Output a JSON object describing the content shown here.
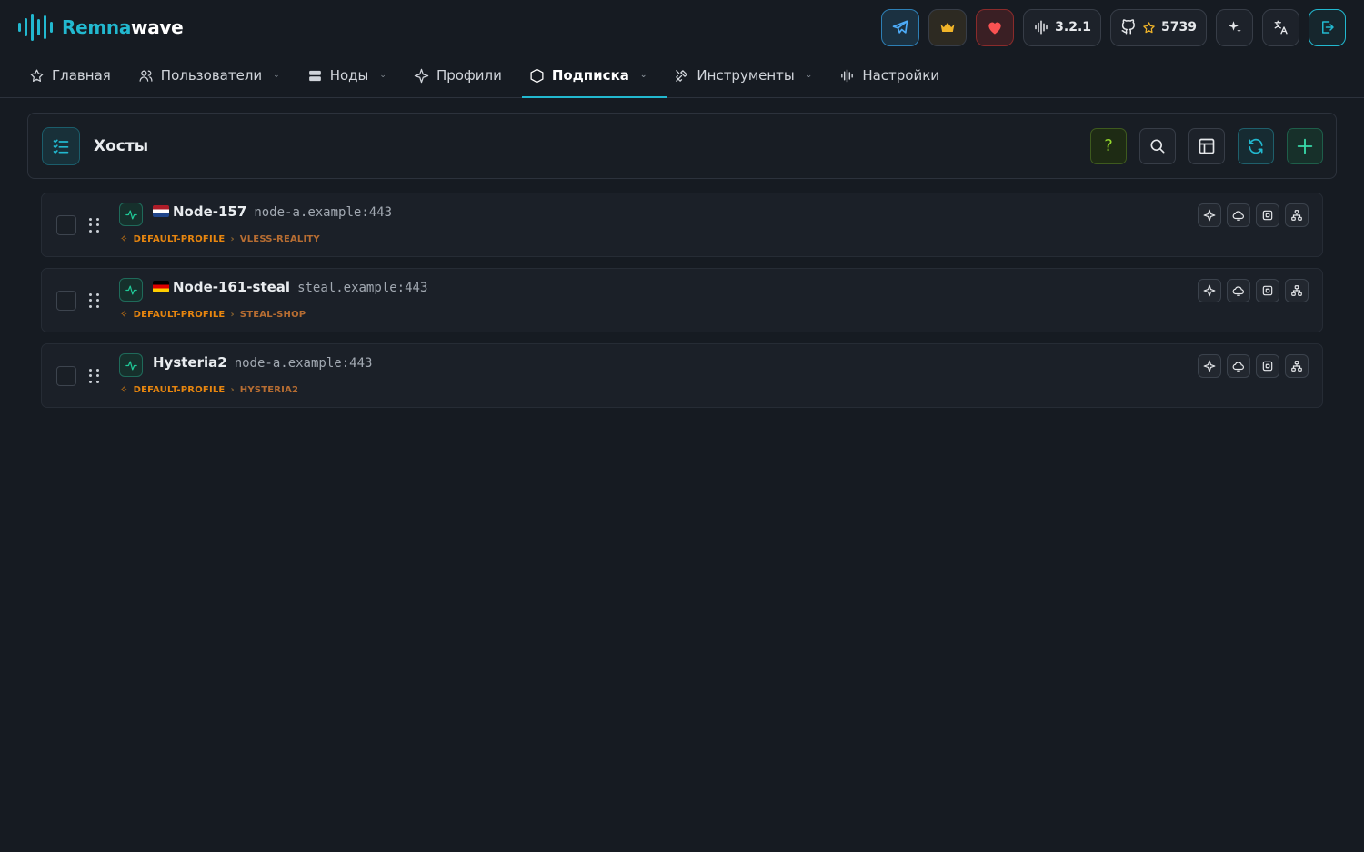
{
  "brand": {
    "name_part1": "Remna",
    "name_part2": "wave"
  },
  "top_actions": {
    "version": "3.2.1",
    "github_stars": "5739"
  },
  "nav": [
    {
      "label": "Главная",
      "icon": "star-icon",
      "has_dropdown": false
    },
    {
      "label": "Пользователи",
      "icon": "users-icon",
      "has_dropdown": true
    },
    {
      "label": "Ноды",
      "icon": "server-icon",
      "has_dropdown": true
    },
    {
      "label": "Профили",
      "icon": "sparkle-icon",
      "has_dropdown": false
    },
    {
      "label": "Подписка",
      "icon": "hexagon-icon",
      "has_dropdown": true,
      "active": true
    },
    {
      "label": "Инструменты",
      "icon": "tools-icon",
      "has_dropdown": true
    },
    {
      "label": "Настройки",
      "icon": "wave-icon",
      "has_dropdown": false
    }
  ],
  "panel": {
    "title": "Хосты",
    "help_label": "?"
  },
  "hosts": [
    {
      "flag": "nl",
      "name": "Node-157",
      "address": "node-a.example:443",
      "profile": "DEFAULT-PROFILE",
      "inbound": "VLESS-REALITY"
    },
    {
      "flag": "de",
      "name": "Node-161-steal",
      "address": "steal.example:443",
      "profile": "DEFAULT-PROFILE",
      "inbound": "STEAL-SHOP"
    },
    {
      "flag": "",
      "name": "Hysteria2",
      "address": "node-a.example:443",
      "profile": "DEFAULT-PROFILE",
      "inbound": "HYSTERIA2"
    }
  ],
  "path_separator": "›",
  "colors": {
    "accent": "#22b8cf",
    "background": "#161b22",
    "profile": "#e8860f"
  }
}
